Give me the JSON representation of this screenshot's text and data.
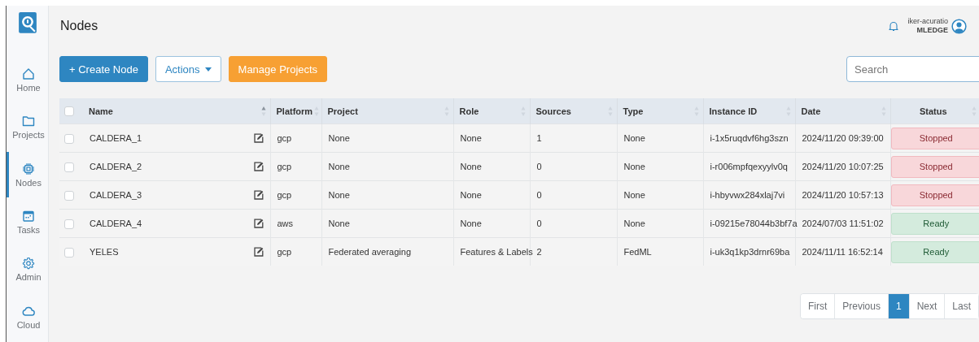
{
  "sidebar": {
    "items": [
      {
        "label": "Home",
        "selected": false
      },
      {
        "label": "Projects",
        "selected": false
      },
      {
        "label": "Nodes",
        "selected": true
      },
      {
        "label": "Tasks",
        "selected": false
      },
      {
        "label": "Admin",
        "selected": false
      },
      {
        "label": "Cloud",
        "selected": false
      }
    ]
  },
  "header": {
    "title": "Nodes",
    "user": {
      "name": "iker-acuratio",
      "org": "MLEDGE"
    }
  },
  "toolbar": {
    "create": "+ Create Node",
    "actions": "Actions",
    "manage": "Manage Projects",
    "search": {
      "placeholder": "Search"
    }
  },
  "table": {
    "select_all": {
      "checked": false
    },
    "columns": [
      {
        "label": "Name",
        "sorted": true
      },
      {
        "label": "Platform",
        "sorted": false
      },
      {
        "label": "Project",
        "sorted": false
      },
      {
        "label": "Role",
        "sorted": false
      },
      {
        "label": "Sources",
        "sorted": false
      },
      {
        "label": "Type",
        "sorted": false
      },
      {
        "label": "Instance ID",
        "sorted": false
      },
      {
        "label": "Date",
        "sorted": false
      },
      {
        "label": "Status",
        "sorted": false
      }
    ],
    "rows": [
      {
        "checked": false,
        "name": "CALDERA_1",
        "platform": "gcp",
        "project": "None",
        "role": "None",
        "sources": "1",
        "type": "None",
        "instance_id": "i-1x5ruqdvf6hg3szn",
        "date": "2024/11/20 09:39:00",
        "status": {
          "text": "Stopped",
          "kind": "stopped"
        }
      },
      {
        "checked": false,
        "name": "CALDERA_2",
        "platform": "gcp",
        "project": "None",
        "role": "None",
        "sources": "0",
        "type": "None",
        "instance_id": "i-r006mpfqexyylv0q",
        "date": "2024/11/20 10:07:25",
        "status": {
          "text": "Stopped",
          "kind": "stopped"
        }
      },
      {
        "checked": false,
        "name": "CALDERA_3",
        "platform": "gcp",
        "project": "None",
        "role": "None",
        "sources": "0",
        "type": "None",
        "instance_id": "i-hbyvwx284xlaj7vi",
        "date": "2024/11/20 10:57:13",
        "status": {
          "text": "Stopped",
          "kind": "stopped"
        }
      },
      {
        "checked": false,
        "name": "CALDERA_4",
        "platform": "aws",
        "project": "None",
        "role": "None",
        "sources": "0",
        "type": "None",
        "instance_id": "i-09215e78044b3bf7a",
        "date": "2024/07/03 11:51:02",
        "status": {
          "text": "Ready",
          "kind": "ready"
        }
      },
      {
        "checked": false,
        "name": "YELES",
        "platform": "gcp",
        "project": "Federated averaging",
        "role": "Features & Labels",
        "sources": "2",
        "type": "FedML",
        "instance_id": "i-uk3q1kp3drnr69ba",
        "date": "2024/11/11 16:52:14",
        "status": {
          "text": "Ready",
          "kind": "ready"
        }
      }
    ]
  },
  "pagination": [
    {
      "label": "First",
      "selected": false
    },
    {
      "label": "Previous",
      "selected": false
    },
    {
      "label": "1",
      "selected": true
    },
    {
      "label": "Next",
      "selected": false
    },
    {
      "label": "Last",
      "selected": false
    }
  ]
}
